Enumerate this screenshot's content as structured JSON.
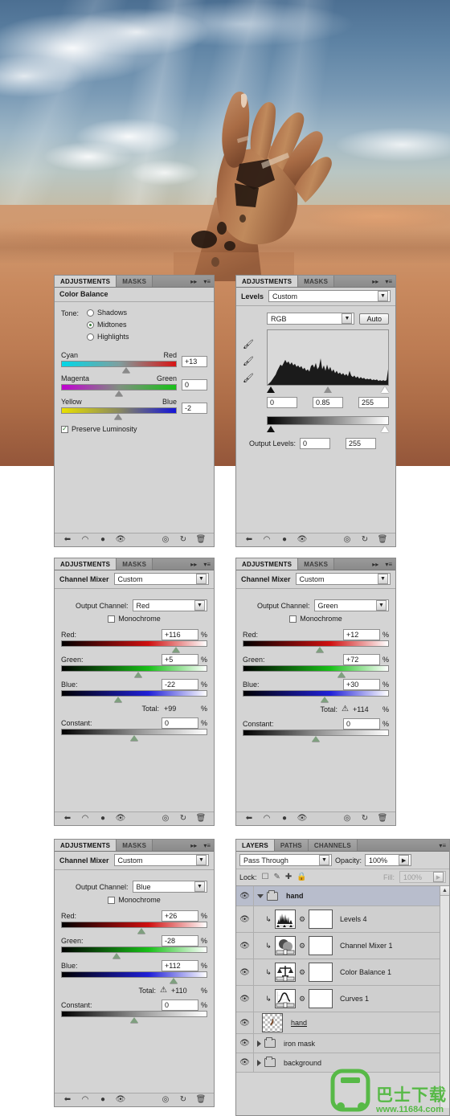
{
  "photo": {
    "alt": "rusty metal hand rising from desert sand under cloudy sky",
    "sky_color": "#5e83a4",
    "sand_color": "#c98a5f",
    "hand_color": "#b2704a"
  },
  "panel_tabs": {
    "adjustments": "ADJUSTMENTS",
    "masks": "MASKS",
    "collapse": "▸▸",
    "menu": "▾≡"
  },
  "color_balance": {
    "title": "Color Balance",
    "tone_label": "Tone:",
    "tone_options": [
      "Shadows",
      "Midtones",
      "Highlights"
    ],
    "tone_selected": "Midtones",
    "sliders": [
      {
        "left": "Cyan",
        "right": "Red",
        "value": "+13",
        "knob_pct": 56
      },
      {
        "left": "Magenta",
        "right": "Green",
        "value": "0",
        "knob_pct": 50
      },
      {
        "left": "Yellow",
        "right": "Blue",
        "value": "-2",
        "knob_pct": 49
      }
    ],
    "preserve_luminosity_label": "Preserve Luminosity",
    "preserve_luminosity_checked": true
  },
  "levels": {
    "title": "Levels",
    "preset": "Custom",
    "channel": "RGB",
    "auto_label": "Auto",
    "input_black": "0",
    "input_gamma": "0.85",
    "input_white": "255",
    "output_levels_label": "Output Levels:",
    "output_black": "0",
    "output_white": "255",
    "eyedroppers": [
      "black-point-eyedropper",
      "gray-point-eyedropper",
      "white-point-eyedropper"
    ]
  },
  "channel_mixer_red": {
    "title": "Channel Mixer",
    "preset": "Custom",
    "output_channel_label": "Output Channel:",
    "output_channel": "Red",
    "monochrome_label": "Monochrome",
    "monochrome_checked": false,
    "sliders": [
      {
        "name": "Red:",
        "value": "+116",
        "unit": "%",
        "knob_pct": 79
      },
      {
        "name": "Green:",
        "value": "+5",
        "unit": "%",
        "knob_pct": 53
      },
      {
        "name": "Blue:",
        "value": "-22",
        "unit": "%",
        "knob_pct": 39
      }
    ],
    "total_label": "Total:",
    "total_value": "+99",
    "total_unit": "%",
    "total_warning": false,
    "constant_label": "Constant:",
    "constant_value": "0",
    "constant_unit": "%",
    "constant_knob_pct": 50
  },
  "channel_mixer_green": {
    "title": "Channel Mixer",
    "preset": "Custom",
    "output_channel_label": "Output Channel:",
    "output_channel": "Green",
    "monochrome_label": "Monochrome",
    "monochrome_checked": false,
    "sliders": [
      {
        "name": "Red:",
        "value": "+12",
        "unit": "%",
        "knob_pct": 53
      },
      {
        "name": "Green:",
        "value": "+72",
        "unit": "%",
        "knob_pct": 68
      },
      {
        "name": "Blue:",
        "value": "+30",
        "unit": "%",
        "knob_pct": 56
      }
    ],
    "total_label": "Total:",
    "total_value": "+114",
    "total_unit": "%",
    "total_warning": true,
    "constant_label": "Constant:",
    "constant_value": "0",
    "constant_unit": "%",
    "constant_knob_pct": 50
  },
  "channel_mixer_blue": {
    "title": "Channel Mixer",
    "preset": "Custom",
    "output_channel_label": "Output Channel:",
    "output_channel": "Blue",
    "monochrome_label": "Monochrome",
    "monochrome_checked": false,
    "sliders": [
      {
        "name": "Red:",
        "value": "+26",
        "unit": "%",
        "knob_pct": 55
      },
      {
        "name": "Green:",
        "value": "-28",
        "unit": "%",
        "knob_pct": 38
      },
      {
        "name": "Blue:",
        "value": "+112",
        "unit": "%",
        "knob_pct": 77
      }
    ],
    "total_label": "Total:",
    "total_value": "+110",
    "total_unit": "%",
    "total_warning": true,
    "constant_label": "Constant:",
    "constant_value": "0",
    "constant_unit": "%",
    "constant_knob_pct": 50
  },
  "panel_tools": {
    "icons": [
      "back-arrow-icon",
      "clip-to-layer-icon",
      "preview-toggle-icon",
      "eye-icon",
      "mask-view-icon",
      "reset-icon",
      "delete-icon"
    ]
  },
  "layers": {
    "tabs": [
      "LAYERS",
      "PATHS",
      "CHANNELS"
    ],
    "active_tab": "LAYERS",
    "blend_mode": "Pass Through",
    "opacity_label": "Opacity:",
    "opacity_value": "100%",
    "lock_label": "Lock:",
    "lock_icons": [
      "lock-transparent-pixels-icon",
      "lock-image-pixels-icon",
      "lock-position-icon",
      "lock-all-icon"
    ],
    "fill_label": "Fill:",
    "fill_value": "100%",
    "rows": [
      {
        "name": "hand",
        "type": "group",
        "expanded": true,
        "selected": true,
        "indent": 0,
        "thumb": "none",
        "mask": false,
        "clipped": false,
        "underline": false
      },
      {
        "name": "Levels 4",
        "type": "adjustment",
        "expanded": false,
        "selected": false,
        "indent": 1,
        "thumb": "levels-icon",
        "mask": true,
        "clipped": true,
        "underline": false
      },
      {
        "name": "Channel Mixer 1",
        "type": "adjustment",
        "expanded": false,
        "selected": false,
        "indent": 1,
        "thumb": "channel-mixer-icon",
        "mask": true,
        "clipped": true,
        "underline": false
      },
      {
        "name": "Color Balance 1",
        "type": "adjustment",
        "expanded": false,
        "selected": false,
        "indent": 1,
        "thumb": "color-balance-icon",
        "mask": true,
        "clipped": true,
        "underline": false
      },
      {
        "name": "Curves 1",
        "type": "adjustment",
        "expanded": false,
        "selected": false,
        "indent": 1,
        "thumb": "curves-icon",
        "mask": true,
        "clipped": true,
        "underline": false
      },
      {
        "name": "hand",
        "type": "pixel",
        "expanded": false,
        "selected": false,
        "indent": 0,
        "thumb": "layer-thumbnail",
        "mask": false,
        "clipped": false,
        "underline": true
      },
      {
        "name": "iron mask",
        "type": "group",
        "expanded": false,
        "selected": false,
        "indent": 0,
        "thumb": "none",
        "mask": false,
        "clipped": false,
        "underline": false
      },
      {
        "name": "background",
        "type": "group",
        "expanded": false,
        "selected": false,
        "indent": 0,
        "thumb": "none",
        "mask": false,
        "clipped": false,
        "underline": false
      }
    ]
  },
  "watermark": {
    "chinese": "巴士下载",
    "url": "www.11684.com",
    "color": "#57b947"
  }
}
